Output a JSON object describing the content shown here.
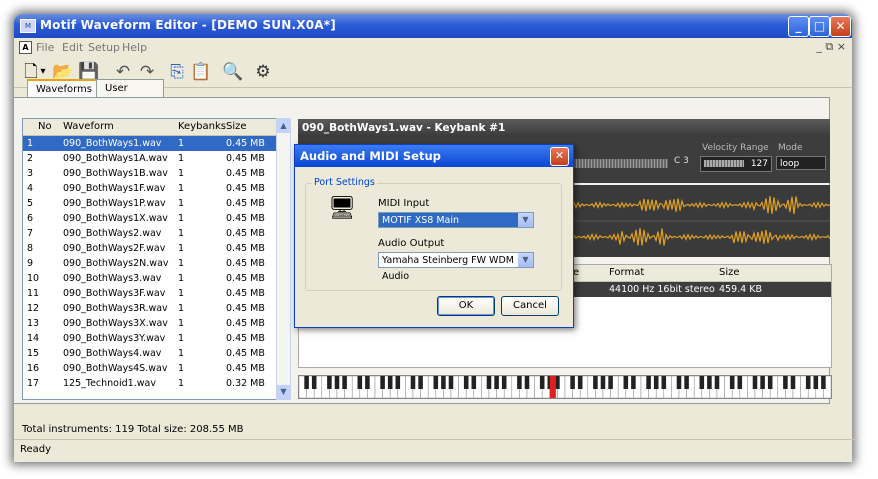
{
  "window": {
    "title": "Motif Waveform Editor - [DEMO SUN.X0A*]",
    "minimize_glyph": "_",
    "maximize_glyph": "□",
    "close_glyph": "✕",
    "mdi_controls": "_ ⧉ ×"
  },
  "menu": {
    "doc_icon": "A",
    "items": [
      "File",
      "Edit",
      "Setup",
      "Help"
    ]
  },
  "toolbar": {
    "icons": [
      {
        "name": "new-icon",
        "glyph": "🗋"
      },
      {
        "name": "dropdown-arrow-icon",
        "glyph": "▾"
      },
      {
        "name": "open-icon",
        "glyph": "📂"
      },
      {
        "name": "save-icon",
        "glyph": "💾"
      },
      {
        "name": "undo-icon",
        "glyph": "↶"
      },
      {
        "name": "redo-icon",
        "glyph": "↷"
      },
      {
        "name": "copy-icon",
        "glyph": "⎘"
      },
      {
        "name": "paste-icon",
        "glyph": "📋"
      },
      {
        "name": "search-icon",
        "glyph": "🔍"
      },
      {
        "name": "keyboard-settings-icon",
        "glyph": "⚙"
      }
    ]
  },
  "tabs": [
    "Waveforms",
    "User Voices"
  ],
  "list": {
    "headers": [
      "No",
      "Waveform",
      "Keybanks",
      "Size"
    ],
    "rows": [
      [
        "1",
        "090_BothWays1.wav",
        "1",
        "0.45 MB"
      ],
      [
        "2",
        "090_BothWays1A.wav",
        "1",
        "0.45 MB"
      ],
      [
        "3",
        "090_BothWays1B.wav",
        "1",
        "0.45 MB"
      ],
      [
        "4",
        "090_BothWays1F.wav",
        "1",
        "0.45 MB"
      ],
      [
        "5",
        "090_BothWays1P.wav",
        "1",
        "0.45 MB"
      ],
      [
        "6",
        "090_BothWays1X.wav",
        "1",
        "0.45 MB"
      ],
      [
        "7",
        "090_BothWays2.wav",
        "1",
        "0.45 MB"
      ],
      [
        "8",
        "090_BothWays2F.wav",
        "1",
        "0.45 MB"
      ],
      [
        "9",
        "090_BothWays2N.wav",
        "1",
        "0.45 MB"
      ],
      [
        "10",
        "090_BothWays3.wav",
        "1",
        "0.45 MB"
      ],
      [
        "11",
        "090_BothWays3F.wav",
        "1",
        "0.45 MB"
      ],
      [
        "12",
        "090_BothWays3R.wav",
        "1",
        "0.45 MB"
      ],
      [
        "13",
        "090_BothWays3X.wav",
        "1",
        "0.45 MB"
      ],
      [
        "14",
        "090_BothWays3Y.wav",
        "1",
        "0.45 MB"
      ],
      [
        "15",
        "090_BothWays4.wav",
        "1",
        "0.45 MB"
      ],
      [
        "16",
        "090_BothWays4S.wav",
        "1",
        "0.45 MB"
      ],
      [
        "17",
        "125_Technoid1.wav",
        "1",
        "0.32 MB"
      ]
    ],
    "selected_index": 0
  },
  "right": {
    "header": "090_BothWays1.wav - Keybank #1",
    "velocity_label": "Velocity Range",
    "mode_label": "Mode",
    "key_note": "C 3",
    "velocity_value": "127",
    "mode_value": "loop",
    "table_headers": [
      "e",
      "Format",
      "Size"
    ],
    "table_row": [
      "",
      "44100 Hz  16bit  stereo",
      "459.4 KB"
    ],
    "waveform_color": "#e0a020"
  },
  "dialog": {
    "title": "Audio and MIDI Setup",
    "group_label": "Port Settings",
    "midi_input_label": "MIDI Input",
    "midi_input_value": "MOTIF XS8 Main",
    "audio_output_label": "Audio Output",
    "audio_output_value": "Yamaha Steinberg FW WDM Audio",
    "ok_label": "OK",
    "cancel_label": "Cancel",
    "device_glyph": "🖥"
  },
  "status": {
    "totals": "Total instruments: 119   Total size: 208.55 MB",
    "ready": "Ready"
  },
  "accent": {
    "selection": "#316ac5",
    "title_blue": "#2b5bd8",
    "key_marker": "#e02020"
  }
}
